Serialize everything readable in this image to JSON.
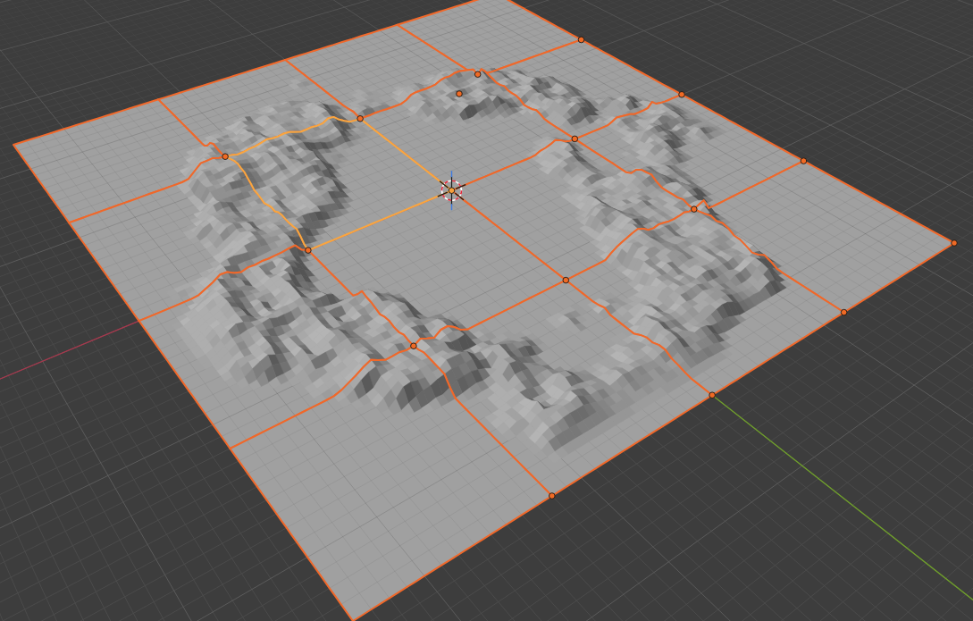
{
  "viewport": {
    "tiles": [
      {
        "selected": true,
        "active": false
      },
      {
        "selected": true,
        "active": false
      },
      {
        "selected": true,
        "active": false
      },
      {
        "selected": true,
        "active": false
      },
      {
        "selected": true,
        "active": false
      },
      {
        "selected": true,
        "active": false
      },
      {
        "selected": true,
        "active": false
      },
      {
        "selected": true,
        "active": false
      },
      {
        "selected": true,
        "active": false
      },
      {
        "selected": true,
        "active": true
      },
      {
        "selected": true,
        "active": false
      },
      {
        "selected": true,
        "active": false
      },
      {
        "selected": true,
        "active": false
      },
      {
        "selected": true,
        "active": false
      },
      {
        "selected": true,
        "active": false
      },
      {
        "selected": true,
        "active": false
      }
    ]
  }
}
